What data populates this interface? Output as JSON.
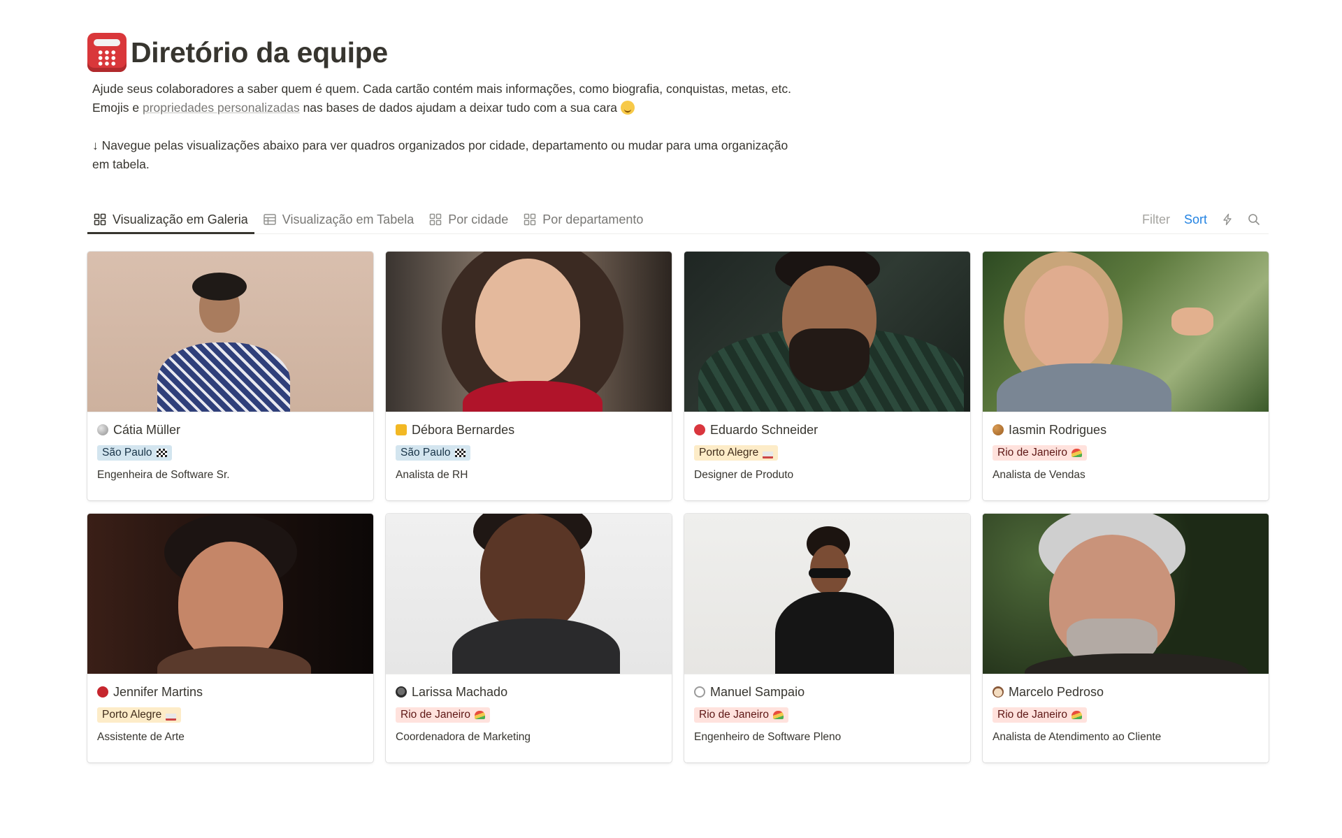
{
  "page": {
    "title": "Diretório da equipe",
    "title_icon": "telephone-icon",
    "desc_part1": "Ajude seus colaboradores a saber quem é quem. Cada cartão contém mais informações, como biografia, conquistas, metas, etc. Emojis e ",
    "desc_link": "propriedades personalizadas",
    "desc_part2": " nas bases de dados ajudam a deixar tudo com a sua cara ",
    "desc_emoji": "winking-face-icon",
    "desc_note": "↓ Navegue pelas visualizações abaixo para ver quadros organizados por cidade, departamento ou mudar para uma organização em tabela."
  },
  "views": {
    "tabs": [
      {
        "label": "Visualização em Galeria",
        "icon": "gallery-grid-icon",
        "active": true
      },
      {
        "label": "Visualização em Tabela",
        "icon": "table-icon",
        "active": false
      },
      {
        "label": "Por cidade",
        "icon": "board-grid-icon",
        "active": false
      },
      {
        "label": "Por departamento",
        "icon": "board-grid-icon",
        "active": false
      }
    ],
    "filter_label": "Filter",
    "sort_label": "Sort",
    "automation_icon": "lightning-icon",
    "search_icon": "search-icon"
  },
  "colors": {
    "accent": "#2383e2",
    "tag_sao_paulo": "#d3e5ef",
    "tag_porto_alegre": "#fdecc8",
    "tag_rio": "#ffe2dd"
  },
  "cards": [
    {
      "name": "Cátia Müller",
      "emoji": "moon-icon",
      "city": "São Paulo",
      "city_icon": "checkered-flag-icon",
      "role": "Engenheira de Software Sr."
    },
    {
      "name": "Débora Bernardes",
      "emoji": "crown-icon",
      "city": "São Paulo",
      "city_icon": "checkered-flag-icon",
      "role": "Analista de RH"
    },
    {
      "name": "Eduardo Schneider",
      "emoji": "ping-pong-icon",
      "city": "Porto Alegre",
      "city_icon": "bathtub-icon",
      "role": "Designer de Produto"
    },
    {
      "name": "Iasmin Rodrigues",
      "emoji": "cookie-icon",
      "city": "Rio de Janeiro",
      "city_icon": "beach-umbrella-icon",
      "role": "Analista de Vendas"
    },
    {
      "name": "Jennifer Martins",
      "emoji": "rose-icon",
      "city": "Porto Alegre",
      "city_icon": "bathtub-icon",
      "role": "Assistente de Arte"
    },
    {
      "name": "Larissa Machado",
      "emoji": "raccoon-icon",
      "city": "Rio de Janeiro",
      "city_icon": "beach-umbrella-icon",
      "role": "Coordenadora de Marketing"
    },
    {
      "name": "Manuel Sampaio",
      "emoji": "headphones-icon",
      "city": "Rio de Janeiro",
      "city_icon": "beach-umbrella-icon",
      "role": "Engenheiro de Software Pleno"
    },
    {
      "name": "Marcelo Pedroso",
      "emoji": "dog-face-icon",
      "city": "Rio de Janeiro",
      "city_icon": "beach-umbrella-icon",
      "role": "Analista de Atendimento ao Cliente"
    }
  ]
}
